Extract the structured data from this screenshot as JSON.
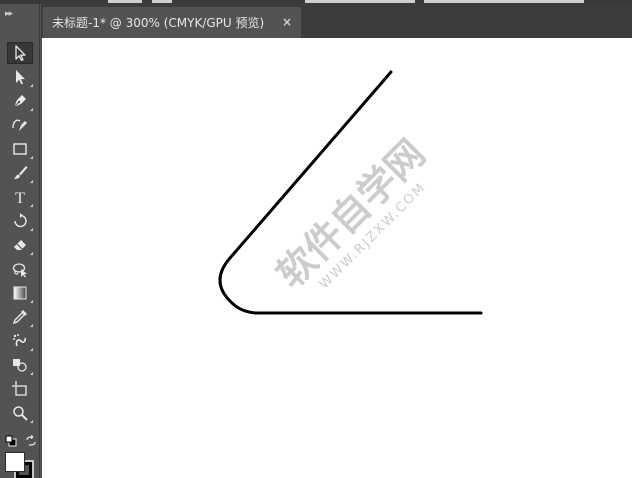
{
  "document_tab": {
    "title": "未标题-1* @ 300% (CMYK/GPU 预览)",
    "close_glyph": "×"
  },
  "toolbar": {
    "grip_glyph": "▸▸",
    "tools": [
      {
        "name": "selection-tool",
        "icon": "arrow-outline-icon",
        "active": true
      },
      {
        "name": "direct-selection-tool",
        "icon": "arrow-filled-icon"
      },
      {
        "name": "pen-tool",
        "icon": "pen-nib-icon"
      },
      {
        "name": "curvature-tool",
        "icon": "curvature-pen-icon"
      },
      {
        "name": "rectangle-tool",
        "icon": "rectangle-icon"
      },
      {
        "name": "paintbrush-tool",
        "icon": "paintbrush-icon"
      },
      {
        "name": "type-tool",
        "icon": "type-t-icon",
        "label": "T"
      },
      {
        "name": "rotate-tool",
        "icon": "rotate-icon"
      },
      {
        "name": "eraser-tool",
        "icon": "eraser-icon"
      },
      {
        "name": "lasso-tool",
        "icon": "lasso-icon"
      },
      {
        "name": "gradient-tool",
        "icon": "gradient-icon"
      },
      {
        "name": "eyedropper-tool",
        "icon": "eyedropper-icon"
      },
      {
        "name": "symbol-sprayer-tool",
        "icon": "symbol-sprayer-icon"
      },
      {
        "name": "shape-builder-tool",
        "icon": "shape-builder-icon"
      },
      {
        "name": "artboard-tool",
        "icon": "artboard-icon"
      },
      {
        "name": "zoom-tool",
        "icon": "magnifier-icon"
      }
    ],
    "colors": {
      "fill": "#ffffff",
      "stroke": "#000000"
    }
  },
  "watermark": {
    "main": "软件自学网",
    "sub": "WWW.RJZXW.COM"
  },
  "colors": {
    "panel": "#535353",
    "tab_bar": "#3c3c3c",
    "canvas": "#ffffff",
    "path_stroke": "#000000"
  }
}
